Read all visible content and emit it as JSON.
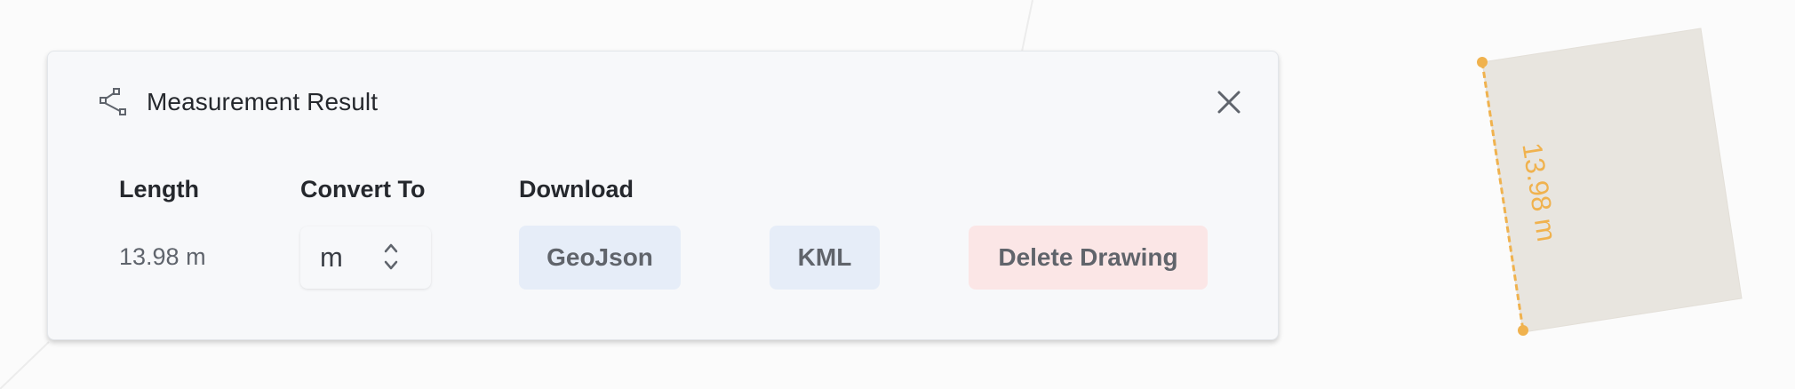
{
  "panel": {
    "title": "Measurement Result",
    "headers": {
      "length": "Length",
      "convert": "Convert To",
      "download": "Download"
    },
    "length_value": "13.98 m",
    "unit_selected": "m",
    "buttons": {
      "geojson": "GeoJson",
      "kml": "KML",
      "delete": "Delete Drawing"
    }
  },
  "map": {
    "measure_label": "13.98 m"
  },
  "colors": {
    "accent_orange": "#f0b24e",
    "polygon_fill": "#e8e5df",
    "button_blue_bg": "#e6edf8",
    "button_red_bg": "#fbe6e6"
  },
  "icons": {
    "title_icon": "measure-line-icon",
    "close_icon": "close-icon",
    "select_icon": "chevron-up-down-icon"
  }
}
